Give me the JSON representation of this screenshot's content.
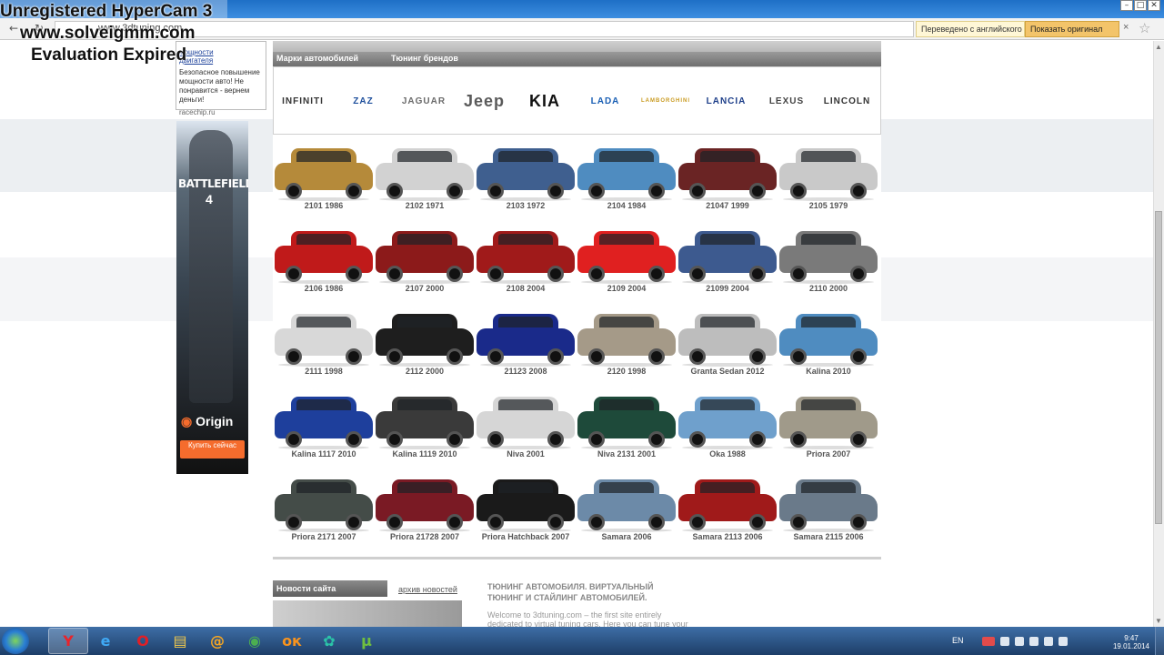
{
  "watermark": {
    "line1": "Unregistered HyperCam 3",
    "line2": "www.solveigmm.com",
    "line3": "Evaluation Expired"
  },
  "browser": {
    "url": "www.3dtuning.com",
    "translated_label": "Переведено с английского",
    "show_original_label": "Показать оригинал",
    "close_glyph": "×",
    "star_glyph": "☆",
    "back_glyph": "←",
    "refresh_glyph": "↻",
    "window_controls": [
      "–",
      "□",
      "✕"
    ]
  },
  "sidebar_ad": {
    "link1": "мощности",
    "link2": "двигателя",
    "text": "Безопасное повышение мощности авто! Не понравится - вернем деньги!",
    "source": "racechip.ru"
  },
  "banner": {
    "title": "BATTLEFIELD",
    "number": "4",
    "brand": "Origin",
    "buy_label": "Купить сейчас"
  },
  "menu": {
    "item1": "Марки автомобилей",
    "item2": "Тюнинг брендов"
  },
  "brands": [
    {
      "name": "INFINITI",
      "color": "#333333"
    },
    {
      "name": "ZAZ",
      "color": "#1e4f9c"
    },
    {
      "name": "JAGUAR",
      "color": "#6b6b6b"
    },
    {
      "name": "Jeep",
      "color": "#5a5a5a"
    },
    {
      "name": "KIA",
      "color": "#111111"
    },
    {
      "name": "LADA",
      "color": "#1a5fb4"
    },
    {
      "name": "LAMBORGHINI",
      "color": "#c99a1f"
    },
    {
      "name": "LANCIA",
      "color": "#1e3f8a"
    },
    {
      "name": "LEXUS",
      "color": "#444444"
    },
    {
      "name": "LINCOLN",
      "color": "#333333"
    }
  ],
  "cars": [
    {
      "name": "2101 1986",
      "color": "#b58a3a"
    },
    {
      "name": "2102 1971",
      "color": "#d2d2d2"
    },
    {
      "name": "2103 1972",
      "color": "#3f5f8f"
    },
    {
      "name": "2104 1984",
      "color": "#4f8cc0"
    },
    {
      "name": "21047 1999",
      "color": "#6a2424"
    },
    {
      "name": "2105 1979",
      "color": "#c9c9c9"
    },
    {
      "name": "2106 1986",
      "color": "#c01a1a"
    },
    {
      "name": "2107 2000",
      "color": "#8c1a1a"
    },
    {
      "name": "2108 2004",
      "color": "#a01a1a"
    },
    {
      "name": "2109 2004",
      "color": "#e02020"
    },
    {
      "name": "21099 2004",
      "color": "#3d5a8f"
    },
    {
      "name": "2110 2000",
      "color": "#7a7a7a"
    },
    {
      "name": "2111 1998",
      "color": "#d8d8d8"
    },
    {
      "name": "2112 2000",
      "color": "#1e1e1e"
    },
    {
      "name": "21123 2008",
      "color": "#1a2a8a"
    },
    {
      "name": "2120 1998",
      "color": "#a59a88"
    },
    {
      "name": "Granta Sedan 2012",
      "color": "#bdbdbd"
    },
    {
      "name": "Kalina 2010",
      "color": "#4f8cc0"
    },
    {
      "name": "Kalina 1117 2010",
      "color": "#1e3f9c"
    },
    {
      "name": "Kalina 1119 2010",
      "color": "#3a3a3a"
    },
    {
      "name": "Niva 2001",
      "color": "#d6d6d6"
    },
    {
      "name": "Niva 2131 2001",
      "color": "#1e4a3a"
    },
    {
      "name": "Oka 1988",
      "color": "#6fa0cc"
    },
    {
      "name": "Priora 2007",
      "color": "#a09a8a"
    },
    {
      "name": "Priora 2171 2007",
      "color": "#444c48"
    },
    {
      "name": "Priora 21728 2007",
      "color": "#7a1a24"
    },
    {
      "name": "Priora Hatchback 2007",
      "color": "#1a1a1a"
    },
    {
      "name": "Samara 2006",
      "color": "#6c8aa8"
    },
    {
      "name": "Samara 2113 2006",
      "color": "#a01a1a"
    },
    {
      "name": "Samara 2115 2006",
      "color": "#6a7a8a"
    }
  ],
  "news": {
    "header": "Новости сайта",
    "archive": "архив новостей"
  },
  "tuning": {
    "title_line1": "ТЮНИНГ АВТОМОБИЛЯ. ВИРТУАЛЬНЫЙ",
    "title_line2": "ТЮНИНГ И СТАЙЛИНГ АВТОМОБИЛЕЙ.",
    "text_line1": "Welcome to 3dtuning.com – the first site entirely",
    "text_line2": "dedicated to virtual tuning cars. Here you can tune your"
  },
  "taskbar": {
    "apps": [
      {
        "icon": "yandex-icon",
        "glyph": "Y",
        "color": "#e8242b"
      },
      {
        "icon": "ie-icon",
        "glyph": "e",
        "color": "#3fa9f5"
      },
      {
        "icon": "opera-icon",
        "glyph": "O",
        "color": "#e01f26"
      },
      {
        "icon": "explorer-icon",
        "glyph": "▤",
        "color": "#f2c94c"
      },
      {
        "icon": "mail-icon",
        "glyph": "@",
        "color": "#f5a623"
      },
      {
        "icon": "chrome-icon",
        "glyph": "◉",
        "color": "#4caf50"
      },
      {
        "icon": "odnoklassniki-icon",
        "glyph": "ок",
        "color": "#f7931e"
      },
      {
        "icon": "spiral-icon",
        "glyph": "✿",
        "color": "#2bc4a8"
      },
      {
        "icon": "utorrent-icon",
        "glyph": "µ",
        "color": "#6fbf3f"
      }
    ],
    "lang": "EN",
    "time": "9:47",
    "date": "19.01.2014"
  }
}
